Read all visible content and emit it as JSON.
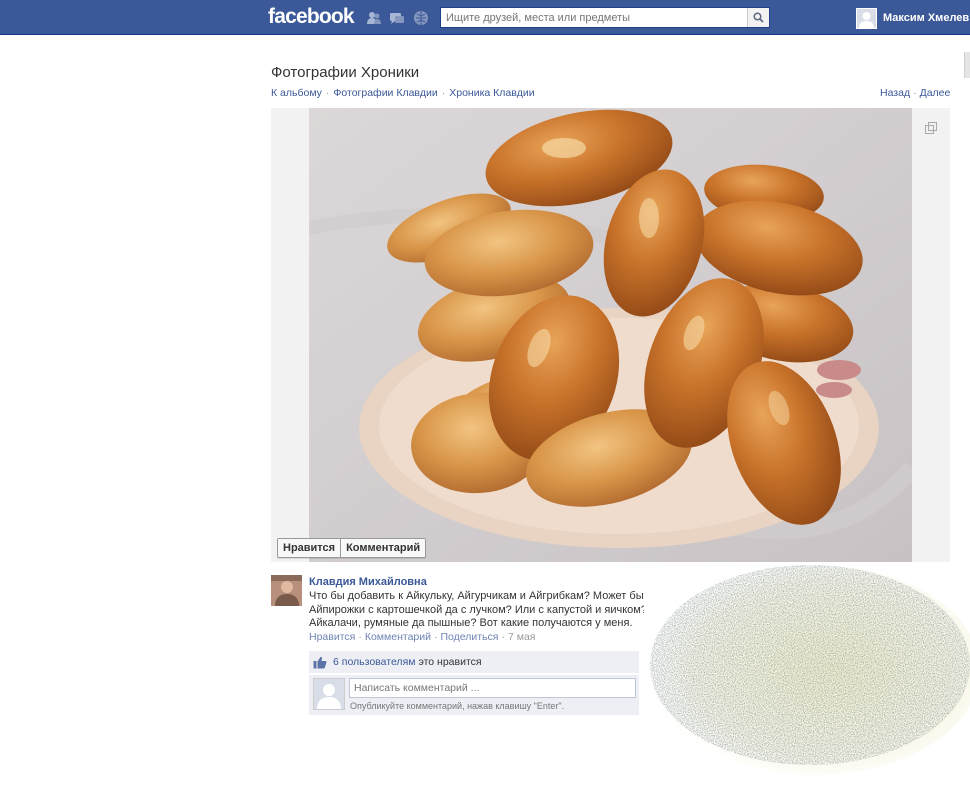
{
  "topbar": {
    "logo": "facebook",
    "search_placeholder": "Ищите друзей, места или предметы",
    "user_name": "Максим Хмелев"
  },
  "header": {
    "title": "Фотографии Хроники",
    "breadcrumbs": [
      "К альбому",
      "Фотографии Клавдии",
      "Хроника Клавдии"
    ],
    "nav": {
      "prev": "Назад",
      "next": "Далее"
    }
  },
  "photo_actions": {
    "like": "Нравится",
    "comment": "Комментарий"
  },
  "post": {
    "author": "Клавдия Михайловна",
    "caption_lines": [
      "Что бы добавить к Айкульку, Айгурчикам и Айгрибкам? Может быт",
      "Айпирожки с картошечкой да с лучком? Или с капустой и яичком? И",
      "Айкалачи, румяные да пышные? Вот какие получаются у меня."
    ],
    "actions": {
      "like": "Нравится",
      "comment": "Комментарий",
      "share": "Поделиться",
      "date": "7 мая"
    },
    "likes": {
      "count_text": "6 пользователям",
      "suffix": "это нравится"
    },
    "comment_input": {
      "placeholder": "Написать комментарий ...",
      "hint": "Опубликуйте комментарий, нажав клавишу \"Enter\"."
    }
  },
  "colors": {
    "brand": "#3b5998",
    "link": "#3b5998",
    "meta_link": "#6d84b4",
    "panel": "#edeff4"
  },
  "icons": [
    "friend-requests-icon",
    "messages-icon",
    "notifications-icon",
    "search-icon",
    "expand-icon",
    "thumbs-up-icon"
  ]
}
